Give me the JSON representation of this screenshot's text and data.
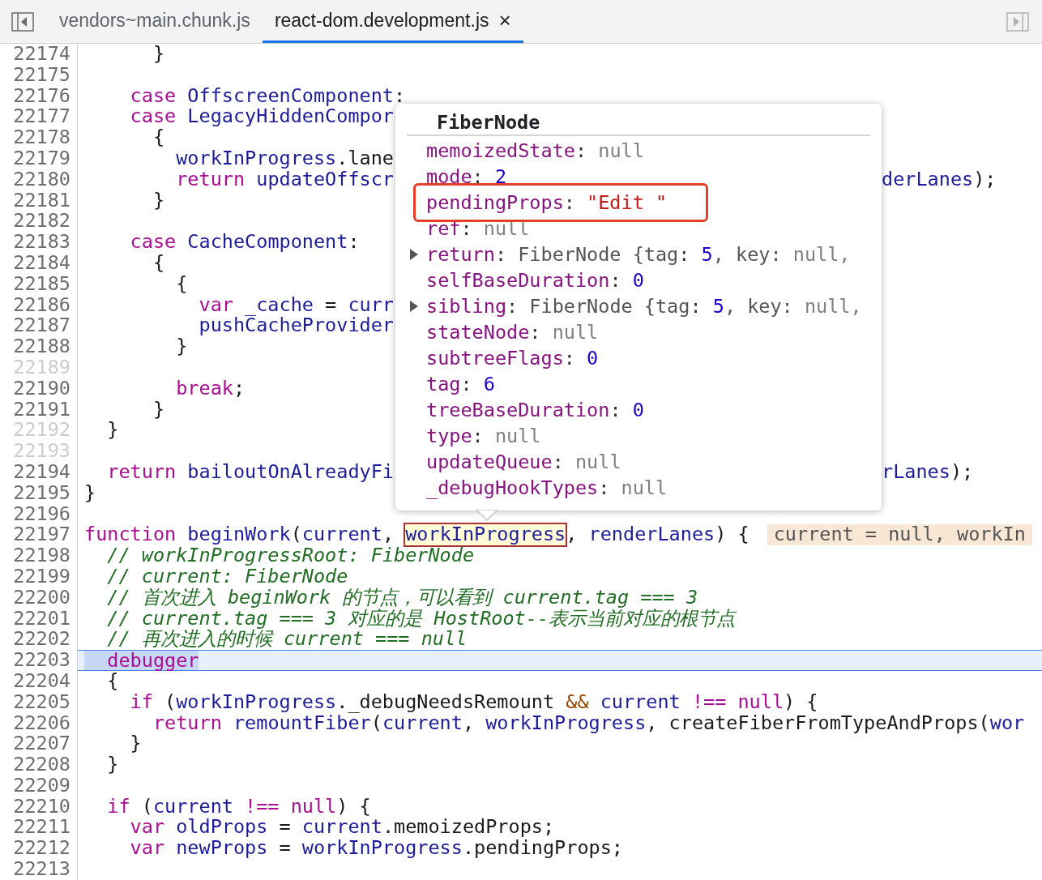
{
  "tabs": [
    {
      "label": "vendors~main.chunk.js",
      "selected": false,
      "closable": false
    },
    {
      "label": "react-dom.development.js",
      "selected": true,
      "closable": true
    }
  ],
  "close_glyph": "×",
  "lines": [
    {
      "number": "22174",
      "breakable": true,
      "current": false,
      "tokens": [
        {
          "text": "      }",
          "kind": "plain"
        }
      ]
    },
    {
      "number": "22175",
      "breakable": true,
      "current": false
    },
    {
      "number": "22176",
      "breakable": true,
      "current": false,
      "tokens": [
        {
          "text": "    case ",
          "kind": "kw"
        },
        {
          "text": "OffscreenComponent",
          "kind": "id"
        },
        {
          "text": ":",
          "kind": "plain"
        }
      ]
    },
    {
      "number": "22177",
      "breakable": true,
      "current": false,
      "tokens": [
        {
          "text": "    case ",
          "kind": "kw"
        },
        {
          "text": "LegacyHiddenCompor",
          "kind": "id"
        }
      ]
    },
    {
      "number": "22178",
      "breakable": true,
      "current": false,
      "tokens": [
        {
          "text": "      {",
          "kind": "plain"
        }
      ]
    },
    {
      "number": "22179",
      "breakable": true,
      "current": false,
      "tokens": [
        {
          "text": "        workInProgress",
          "kind": "id"
        },
        {
          "text": ".lane",
          "kind": "plain"
        }
      ]
    },
    {
      "number": "22180",
      "breakable": true,
      "current": false,
      "tokens": [
        {
          "text": "        return ",
          "kind": "kw"
        },
        {
          "text": "updateOffscr",
          "kind": "id"
        }
      ],
      "right": [
        {
          "text": "derLanes",
          "kind": "id"
        },
        {
          "text": ");",
          "kind": "plain"
        }
      ]
    },
    {
      "number": "22181",
      "breakable": true,
      "current": false,
      "tokens": [
        {
          "text": "      }",
          "kind": "plain"
        }
      ]
    },
    {
      "number": "22182",
      "breakable": true,
      "current": false
    },
    {
      "number": "22183",
      "breakable": true,
      "current": false,
      "tokens": [
        {
          "text": "    case ",
          "kind": "kw"
        },
        {
          "text": "CacheComponent",
          "kind": "id"
        },
        {
          "text": ":",
          "kind": "plain"
        }
      ]
    },
    {
      "number": "22184",
      "breakable": true,
      "current": false,
      "tokens": [
        {
          "text": "      {",
          "kind": "plain"
        }
      ]
    },
    {
      "number": "22185",
      "breakable": true,
      "current": false,
      "tokens": [
        {
          "text": "        {",
          "kind": "plain"
        }
      ]
    },
    {
      "number": "22186",
      "breakable": true,
      "current": false,
      "tokens": [
        {
          "text": "          var ",
          "kind": "kw"
        },
        {
          "text": "_cache",
          "kind": "id"
        },
        {
          "text": " = ",
          "kind": "plain"
        },
        {
          "text": "curr",
          "kind": "id"
        }
      ]
    },
    {
      "number": "22187",
      "breakable": true,
      "current": false,
      "tokens": [
        {
          "text": "          pushCacheProvider",
          "kind": "id"
        }
      ]
    },
    {
      "number": "22188",
      "breakable": true,
      "current": false,
      "tokens": [
        {
          "text": "        }",
          "kind": "plain"
        }
      ]
    },
    {
      "number": "22189",
      "breakable": false,
      "current": false
    },
    {
      "number": "22190",
      "breakable": true,
      "current": false,
      "tokens": [
        {
          "text": "        break",
          "kind": "kw"
        },
        {
          "text": ";",
          "kind": "plain"
        }
      ]
    },
    {
      "number": "22191",
      "breakable": true,
      "current": false,
      "tokens": [
        {
          "text": "      }",
          "kind": "plain"
        }
      ]
    },
    {
      "number": "22192",
      "breakable": false,
      "current": false,
      "tokens": [
        {
          "text": "  }",
          "kind": "plain"
        }
      ]
    },
    {
      "number": "22193",
      "breakable": false,
      "current": false
    },
    {
      "number": "22194",
      "breakable": true,
      "current": false,
      "tokens": [
        {
          "text": "  return ",
          "kind": "kw"
        },
        {
          "text": "bailoutOnAlreadyFi",
          "kind": "id"
        }
      ],
      "right": [
        {
          "text": "rLanes",
          "kind": "id"
        },
        {
          "text": ");",
          "kind": "plain"
        }
      ]
    },
    {
      "number": "22195",
      "breakable": true,
      "current": false,
      "tokens": [
        {
          "text": "}",
          "kind": "plain"
        }
      ]
    },
    {
      "number": "22196",
      "breakable": true,
      "current": false
    },
    {
      "number": "22197",
      "breakable": true,
      "current": false,
      "tokens": [
        {
          "text": "function ",
          "kind": "kw"
        },
        {
          "text": "beginWork",
          "kind": "id"
        },
        {
          "text": "(",
          "kind": "plain"
        },
        {
          "text": "current",
          "kind": "id"
        },
        {
          "text": ", ",
          "kind": "plain"
        },
        {
          "text": "workInProgress",
          "kind": "hovered"
        },
        {
          "text": ", ",
          "kind": "plain"
        },
        {
          "text": "renderLanes",
          "kind": "id"
        },
        {
          "text": ") {",
          "kind": "plain"
        },
        {
          "text": "current = null, workIn",
          "kind": "hint"
        }
      ]
    },
    {
      "number": "22198",
      "breakable": true,
      "current": false,
      "tokens": [
        {
          "text": "  // workInProgressRoot: FiberNode",
          "kind": "comment"
        }
      ]
    },
    {
      "number": "22199",
      "breakable": true,
      "current": false,
      "tokens": [
        {
          "text": "  // current: FiberNode",
          "kind": "comment"
        }
      ]
    },
    {
      "number": "22200",
      "breakable": true,
      "current": false,
      "tokens": [
        {
          "text": "  // 首次进入 beginWork 的节点，可以看到 current.tag === 3",
          "kind": "comment"
        }
      ]
    },
    {
      "number": "22201",
      "breakable": true,
      "current": false,
      "tokens": [
        {
          "text": "  // current.tag === 3 对应的是 HostRoot--表示当前对应的根节点",
          "kind": "comment"
        }
      ]
    },
    {
      "number": "22202",
      "breakable": true,
      "current": false,
      "tokens": [
        {
          "text": "  // 再次进入的时候 current === null",
          "kind": "comment"
        }
      ]
    },
    {
      "number": "22203",
      "breakable": true,
      "current": true,
      "tokens": [
        {
          "text": "  debugger",
          "kind": "kw"
        }
      ]
    },
    {
      "number": "22204",
      "breakable": true,
      "current": false,
      "tokens": [
        {
          "text": "  {",
          "kind": "plain"
        }
      ]
    },
    {
      "number": "22205",
      "breakable": true,
      "current": false,
      "tokens": [
        {
          "text": "    if",
          "kind": "kw"
        },
        {
          "text": " (",
          "kind": "plain"
        },
        {
          "text": "workInProgress",
          "kind": "id"
        },
        {
          "text": "._debugNeedsRemount ",
          "kind": "plain"
        },
        {
          "text": "&&",
          "kind": "op"
        },
        {
          "text": " current ",
          "kind": "id"
        },
        {
          "text": "!== null",
          "kind": "kw"
        },
        {
          "text": ") {",
          "kind": "plain"
        }
      ]
    },
    {
      "number": "22206",
      "breakable": true,
      "current": false,
      "tokens": [
        {
          "text": "      return ",
          "kind": "kw"
        },
        {
          "text": "remountFiber",
          "kind": "id"
        },
        {
          "text": "(",
          "kind": "plain"
        },
        {
          "text": "current",
          "kind": "id"
        },
        {
          "text": ", ",
          "kind": "plain"
        },
        {
          "text": "workInProgress",
          "kind": "id"
        },
        {
          "text": ", createFiberFromTypeAndProps(",
          "kind": "plain"
        },
        {
          "text": "wor",
          "kind": "id"
        }
      ]
    },
    {
      "number": "22207",
      "breakable": true,
      "current": false,
      "tokens": [
        {
          "text": "    }",
          "kind": "plain"
        }
      ]
    },
    {
      "number": "22208",
      "breakable": true,
      "current": false,
      "tokens": [
        {
          "text": "  }",
          "kind": "plain"
        }
      ]
    },
    {
      "number": "22209",
      "breakable": true,
      "current": false
    },
    {
      "number": "22210",
      "breakable": true,
      "current": false,
      "tokens": [
        {
          "text": "  if",
          "kind": "kw"
        },
        {
          "text": " (",
          "kind": "plain"
        },
        {
          "text": "current ",
          "kind": "id"
        },
        {
          "text": "!== null",
          "kind": "kw"
        },
        {
          "text": ") {",
          "kind": "plain"
        }
      ]
    },
    {
      "number": "22211",
      "breakable": true,
      "current": false,
      "tokens": [
        {
          "text": "    var ",
          "kind": "kw"
        },
        {
          "text": "oldProps",
          "kind": "id"
        },
        {
          "text": " = ",
          "kind": "plain"
        },
        {
          "text": "current",
          "kind": "id"
        },
        {
          "text": ".memoizedProps;",
          "kind": "plain"
        }
      ]
    },
    {
      "number": "22212",
      "breakable": true,
      "current": false,
      "tokens": [
        {
          "text": "    var ",
          "kind": "kw"
        },
        {
          "text": "newProps",
          "kind": "id"
        },
        {
          "text": " = ",
          "kind": "plain"
        },
        {
          "text": "workInProgress",
          "kind": "id"
        },
        {
          "text": ".pendingProps;",
          "kind": "plain"
        }
      ]
    },
    {
      "number": "22213",
      "breakable": true,
      "current": false
    }
  ],
  "popover": {
    "title": "FiberNode",
    "properties": [
      {
        "expandable": false,
        "highlighted": false,
        "tokens": [
          {
            "text": "memoizedState",
            "kind": "key"
          },
          {
            "text": ": ",
            "kind": "plain"
          },
          {
            "text": "null",
            "kind": "null"
          }
        ]
      },
      {
        "expandable": false,
        "highlighted": false,
        "tokens": [
          {
            "text": "mode",
            "kind": "key"
          },
          {
            "text": ": ",
            "kind": "plain"
          },
          {
            "text": "2",
            "kind": "num"
          }
        ]
      },
      {
        "expandable": false,
        "highlighted": true,
        "tokens": [
          {
            "text": "pendingProps",
            "kind": "key"
          },
          {
            "text": ": ",
            "kind": "plain"
          },
          {
            "text": "\"Edit \"",
            "kind": "str"
          }
        ]
      },
      {
        "expandable": false,
        "highlighted": false,
        "tokens": [
          {
            "text": "ref",
            "kind": "key"
          },
          {
            "text": ": ",
            "kind": "plain"
          },
          {
            "text": "null",
            "kind": "null"
          }
        ]
      },
      {
        "expandable": true,
        "highlighted": false,
        "tokens": [
          {
            "text": "return",
            "kind": "key"
          },
          {
            "text": ": ",
            "kind": "plain"
          },
          {
            "text": "FiberNode {tag",
            "kind": "obj"
          },
          {
            "text": ": ",
            "kind": "plain"
          },
          {
            "text": "5",
            "kind": "num"
          },
          {
            "text": ", key: ",
            "kind": "obj"
          },
          {
            "text": "null,",
            "kind": "null"
          }
        ]
      },
      {
        "expandable": false,
        "highlighted": false,
        "tokens": [
          {
            "text": "selfBaseDuration",
            "kind": "key"
          },
          {
            "text": ": ",
            "kind": "plain"
          },
          {
            "text": "0",
            "kind": "num"
          }
        ]
      },
      {
        "expandable": true,
        "highlighted": false,
        "tokens": [
          {
            "text": "sibling",
            "kind": "key"
          },
          {
            "text": ": ",
            "kind": "plain"
          },
          {
            "text": "FiberNode {tag",
            "kind": "obj"
          },
          {
            "text": ": ",
            "kind": "plain"
          },
          {
            "text": "5",
            "kind": "num"
          },
          {
            "text": ", key: ",
            "kind": "obj"
          },
          {
            "text": "null,",
            "kind": "null"
          }
        ]
      },
      {
        "expandable": false,
        "highlighted": false,
        "tokens": [
          {
            "text": "stateNode",
            "kind": "key"
          },
          {
            "text": ": ",
            "kind": "plain"
          },
          {
            "text": "null",
            "kind": "null"
          }
        ]
      },
      {
        "expandable": false,
        "highlighted": false,
        "tokens": [
          {
            "text": "subtreeFlags",
            "kind": "key"
          },
          {
            "text": ": ",
            "kind": "plain"
          },
          {
            "text": "0",
            "kind": "num"
          }
        ]
      },
      {
        "expandable": false,
        "highlighted": false,
        "tokens": [
          {
            "text": "tag",
            "kind": "key"
          },
          {
            "text": ": ",
            "kind": "plain"
          },
          {
            "text": "6",
            "kind": "num"
          }
        ]
      },
      {
        "expandable": false,
        "highlighted": false,
        "tokens": [
          {
            "text": "treeBaseDuration",
            "kind": "key"
          },
          {
            "text": ": ",
            "kind": "plain"
          },
          {
            "text": "0",
            "kind": "num"
          }
        ]
      },
      {
        "expandable": false,
        "highlighted": false,
        "tokens": [
          {
            "text": "type",
            "kind": "key"
          },
          {
            "text": ": ",
            "kind": "plain"
          },
          {
            "text": "null",
            "kind": "null"
          }
        ]
      },
      {
        "expandable": false,
        "highlighted": false,
        "tokens": [
          {
            "text": "updateQueue",
            "kind": "key"
          },
          {
            "text": ": ",
            "kind": "plain"
          },
          {
            "text": "null",
            "kind": "null"
          }
        ]
      },
      {
        "expandable": false,
        "highlighted": false,
        "tokens": [
          {
            "text": "_debugHookTypes",
            "kind": "key"
          },
          {
            "text": ": ",
            "kind": "plain"
          },
          {
            "text": "null",
            "kind": "null"
          }
        ]
      }
    ]
  }
}
